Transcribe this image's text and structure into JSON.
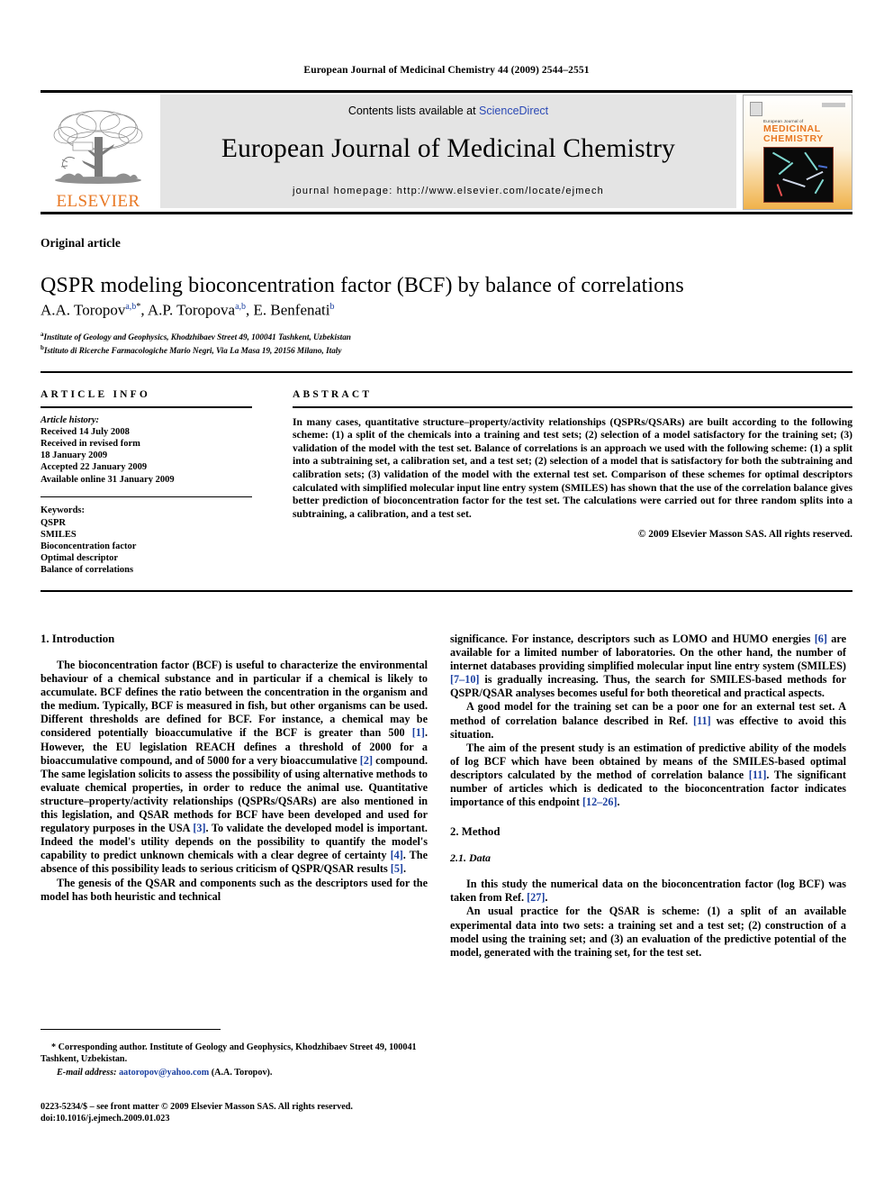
{
  "running_head": "European Journal of Medicinal Chemistry 44 (2009) 2544–2551",
  "masthead": {
    "contents_prefix": "Contents lists available at ",
    "sciencedirect": "ScienceDirect",
    "journal_title": "European Journal of Medicinal Chemistry",
    "homepage": "journal homepage: http://www.elsevier.com/locate/ejmech",
    "publisher_logo_text": "ELSEVIER",
    "cover": {
      "line1": "European Journal of",
      "line2": "MEDICINAL",
      "line3": "CHEMISTRY"
    }
  },
  "article": {
    "type_label": "Original article",
    "title": "QSPR modeling bioconcentration factor (BCF) by balance of correlations",
    "authors": [
      {
        "name": "A.A. Toropov",
        "sup": "a,b",
        "star": true
      },
      {
        "name": "A.P. Toropova",
        "sup": "a,b",
        "star": false
      },
      {
        "name": "E. Benfenati",
        "sup": "b",
        "star": false
      }
    ],
    "affiliations": [
      {
        "mark": "a",
        "text": "Institute of Geology and Geophysics, Khodzhibaev Street 49, 100041 Tashkent, Uzbekistan"
      },
      {
        "mark": "b",
        "text": "Istituto di Ricerche Farmacologiche Mario Negri, Via La Masa 19, 20156 Milano, Italy"
      }
    ]
  },
  "info": {
    "heading": "ARTICLE INFO",
    "history_label": "Article history:",
    "history": [
      "Received 14 July 2008",
      "Received in revised form",
      "18 January 2009",
      "Accepted 22 January 2009",
      "Available online 31 January 2009"
    ],
    "keywords_label": "Keywords:",
    "keywords": [
      "QSPR",
      "SMILES",
      "Bioconcentration factor",
      "Optimal descriptor",
      "Balance of correlations"
    ]
  },
  "abstract": {
    "heading": "ABSTRACT",
    "text": "In many cases, quantitative structure–property/activity relationships (QSPRs/QSARs) are built according to the following scheme: (1) a split of the chemicals into a training and test sets; (2) selection of a model satisfactory for the training set; (3) validation of the model with the test set. Balance of correlations is an approach we used with the following scheme: (1) a split into a subtraining set, a calibration set, and a test set; (2) selection of a model that is satisfactory for both the subtraining and calibration sets; (3) validation of the model with the external test set. Comparison of these schemes for optimal descriptors calculated with simplified molecular input line entry system (SMILES) has shown that the use of the correlation balance gives better prediction of bioconcentration factor for the test set. The calculations were carried out for three random splits into a subtraining, a calibration, and a test set.",
    "copyright": "© 2009 Elsevier Masson SAS. All rights reserved."
  },
  "body": {
    "left": {
      "section1_heading": "1. Introduction",
      "para1_a": "The bioconcentration factor (BCF) is useful to characterize the environmental behaviour of a chemical substance and in particular if a chemical is likely to accumulate. BCF defines the ratio between the concentration in the organism and the medium. Typically, BCF is measured in fish, but other organisms can be used. Different thresholds are defined for BCF. For instance, a chemical may be considered potentially bioaccumulative if the BCF is greater than 500 ",
      "ref1": "[1]",
      "para1_b": ". However, the EU legislation REACH defines a threshold of 2000 for a bioaccumulative compound, and of 5000 for a very bioaccumulative ",
      "ref2": "[2]",
      "para1_c": " compound. The same legislation solicits to assess the possibility of using alternative methods to evaluate chemical properties, in order to reduce the animal use. Quantitative structure–property/activity relationships (QSPRs/QSARs) are also mentioned in this legislation, and QSAR methods for BCF have been developed and used for regulatory purposes in the USA ",
      "ref3": "[3]",
      "para1_d": ". To validate the developed model is important. Indeed the model's utility depends on the possibility to quantify the model's capability to predict unknown chemicals with a clear degree of certainty ",
      "ref4": "[4]",
      "para1_e": ". The absence of this possibility leads to serious criticism of QSPR/QSAR results ",
      "ref5": "[5]",
      "para1_f": ".",
      "para2": "The genesis of the QSAR and components such as the descriptors used for the model has both heuristic and technical"
    },
    "right": {
      "para1_a": "significance. For instance, descriptors such as LOMO and HUMO energies ",
      "ref6": "[6]",
      "para1_b": " are available for a limited number of laboratories. On the other hand, the number of internet databases providing simplified molecular input line entry system (SMILES) ",
      "ref7": "[7–10]",
      "para1_c": " is gradually increasing. Thus, the search for SMILES-based methods for QSPR/QSAR analyses becomes useful for both theoretical and practical aspects.",
      "para2_a": "A good model for the training set can be a poor one for an external test set. A method of correlation balance described in Ref. ",
      "ref11": "[11]",
      "para2_b": " was effective to avoid this situation.",
      "para3_a": "The aim of the present study is an estimation of predictive ability of the models of ",
      "bold_logbcf": "log BCF",
      "para3_b": " which have been obtained by means of the SMILES-based optimal descriptors calculated by the method of correlation balance ",
      "ref11b": "[11]",
      "para3_c": ". The significant number of articles which is dedicated to the bioconcentration factor indicates importance of this endpoint ",
      "ref12": "[12–26]",
      "para3_d": ".",
      "section2_heading": "2. Method",
      "section21_heading": "2.1. Data",
      "para4_a": "In this study the numerical data on the bioconcentration factor (",
      "bold_logbcf2": "log BCF",
      "para4_b": ") was taken from Ref. ",
      "ref27": "[27]",
      "para4_c": ".",
      "para5": "An usual practice for the QSAR is scheme: (1) a split of an available experimental data into two sets: a training set and a test set; (2) construction of a model using the training set; and (3) an evaluation of the predictive potential of the model, generated with the training set, for the test set."
    }
  },
  "footnotes": {
    "corresponding": "* Corresponding author. Institute of Geology and Geophysics, Khodzhibaev Street 49, 100041 Tashkent, Uzbekistan.",
    "email_label": "E-mail address:",
    "email": "aatoropov@yahoo.com",
    "email_suffix": " (A.A. Toropov).",
    "issn_line": "0223-5234/$ – see front matter © 2009 Elsevier Masson SAS. All rights reserved.",
    "doi_line": "doi:10.1016/j.ejmech.2009.01.023"
  },
  "colors": {
    "elsevier_orange": "#E87722",
    "link_blue": "#2b49b5",
    "ref_blue": "#1a3fa0",
    "masthead_grey": "#e4e4e4"
  }
}
